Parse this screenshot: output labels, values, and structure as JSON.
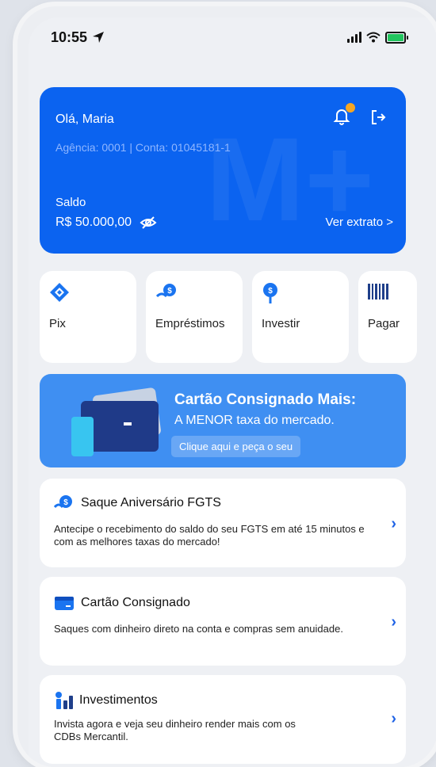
{
  "status_bar": {
    "time": "10:55"
  },
  "header": {
    "greeting": "Olá, Maria",
    "account": "Agência: 0001 | Conta: 01045181-1",
    "balance_label": "Saldo",
    "balance_value": "R$ 50.000,00",
    "statement_link": "Ver extrato >"
  },
  "quick_actions": [
    {
      "label": "Pix",
      "icon": "pix-icon"
    },
    {
      "label": "Empréstimos",
      "icon": "loan-icon"
    },
    {
      "label": "Investir",
      "icon": "invest-icon"
    },
    {
      "label": "Pagar",
      "icon": "barcode-icon"
    }
  ],
  "promo": {
    "title": "Cartão Consignado Mais:",
    "subtitle": "A MENOR taxa do mercado.",
    "cta": "Clique aqui e peça o seu"
  },
  "offers": [
    {
      "title": "Saque Aniversário FGTS",
      "description": "Antecipe o recebimento do saldo do seu FGTS em até 15 minutos e com as melhores taxas do mercado!"
    },
    {
      "title": "Cartão Consignado",
      "description": "Saques com dinheiro direto na conta e compras sem anuidade."
    },
    {
      "title": "Investimentos",
      "description": "Invista agora e veja seu dinheiro render mais com os CDBs Mercantil."
    }
  ],
  "colors": {
    "brand": "#0b63f0",
    "promo": "#3f8ff2",
    "accent": "#f5a623"
  }
}
